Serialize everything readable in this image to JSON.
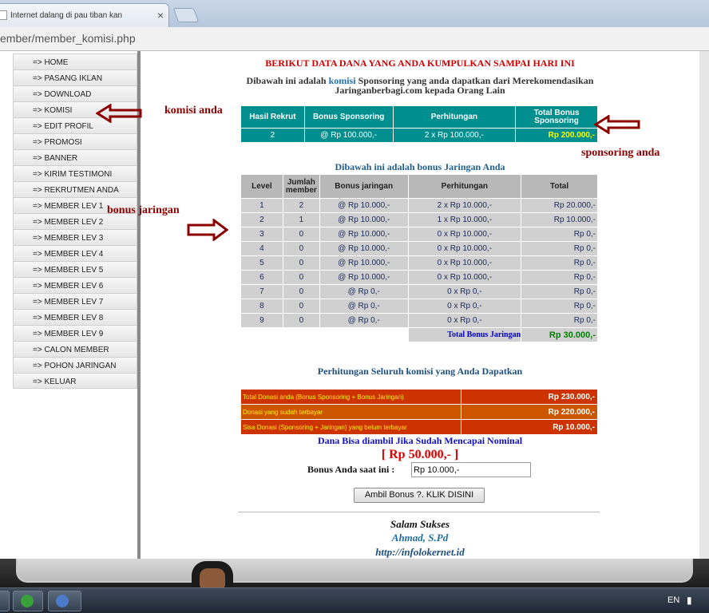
{
  "browser": {
    "tab_title": "Internet dalang di pau tiban kan",
    "url": "ember/member_komisi.php"
  },
  "sidebar": {
    "items": [
      "=> HOME",
      "=> PASANG IKLAN",
      "=> DOWNLOAD",
      "=> KOMISI",
      "=> EDIT PROFIL",
      "=> PROMOSI",
      "=> BANNER",
      "=> KIRIM TESTIMONI",
      "=> REKRUTMEN ANDA",
      "=> MEMBER LEV 1",
      "=> MEMBER LEV 2",
      "=> MEMBER LEV 3",
      "=> MEMBER LEV 4",
      "=> MEMBER LEV 5",
      "=> MEMBER LEV 6",
      "=> MEMBER LEV 7",
      "=> MEMBER LEV 8",
      "=> MEMBER LEV 9",
      "=> CALON MEMBER",
      "=> POHON JARINGAN",
      "=> KELUAR"
    ]
  },
  "main": {
    "heading": "BERIKUT DATA DANA YANG ANDA KUMPULKAN SAMPAI HARI INI",
    "intro_before": "Dibawah ini adalah ",
    "intro_link": "komisi",
    "intro_after": " Sponsoring yang anda dapatkan dari Merekomendasikan Jaringanberbagi.com kepada Orang Lain",
    "sponsor_table": {
      "headers": [
        "Hasil Rekrut",
        "Bonus Sponsoring",
        "Perhitungan",
        "Total Bonus Sponsoring"
      ],
      "row": [
        "2",
        "@ Rp 100.000,-",
        "2 x Rp 100.000,-",
        "Rp 200.000,-"
      ]
    },
    "jaringan_title": "Dibawah ini adalah bonus Jaringan Anda",
    "jaringan_table": {
      "headers": [
        "Level",
        "Jumlah member",
        "Bonus jaringan",
        "Perhitungan",
        "Total"
      ],
      "rows": [
        [
          "1",
          "2",
          "@ Rp 10.000,-",
          "2 x Rp 10.000,-",
          "Rp 20.000,-"
        ],
        [
          "2",
          "1",
          "@ Rp 10.000,-",
          "1 x Rp 10.000,-",
          "Rp 10.000,-"
        ],
        [
          "3",
          "0",
          "@ Rp 10.000,-",
          "0 x Rp 10.000,-",
          "Rp 0,-"
        ],
        [
          "4",
          "0",
          "@ Rp 10.000,-",
          "0 x Rp 10.000,-",
          "Rp 0,-"
        ],
        [
          "5",
          "0",
          "@ Rp 10.000,-",
          "0 x Rp 10.000,-",
          "Rp 0,-"
        ],
        [
          "6",
          "0",
          "@ Rp 10.000,-",
          "0 x Rp 10.000,-",
          "Rp 0,-"
        ],
        [
          "7",
          "0",
          "@ Rp 0,-",
          "0 x Rp 0,-",
          "Rp 0,-"
        ],
        [
          "8",
          "0",
          "@ Rp 0,-",
          "0 x Rp 0,-",
          "Rp 0,-"
        ],
        [
          "9",
          "0",
          "@ Rp 0,-",
          "0 x Rp 0,-",
          "Rp 0,-"
        ]
      ],
      "total_label": "Total Bonus Jaringan",
      "total_value": "Rp 30.000,-"
    },
    "perhitungan_title": "Perhitungan Seluruh komisi yang Anda Dapatkan",
    "summary_table": {
      "rows": [
        [
          "Total Donasi anda (Bonus Sponsoring + Bonus Jaringan)",
          "Rp 230.000,-"
        ],
        [
          "Donasi yang sudah terbayar",
          "Rp 220.000,-"
        ],
        [
          "Sisa Donasi (Sponsoring + Jaringan) yang belum terbayar",
          "Rp 10.000,-"
        ]
      ]
    },
    "dana_text": "Dana Bisa diambil Jika Sudah Mencapai Nominal",
    "nominal": "[ Rp 50.000,- ]",
    "bonus_label": "Bonus Anda saat ini :",
    "bonus_value": "Rp 10.000,-",
    "ambil_button": "Ambil Bonus ?. KLIK DISINI",
    "salam": "Salam Sukses",
    "nama": "Ahmad, S.Pd",
    "website": "http://infolokernet.id"
  },
  "annotations": {
    "komisi": "komisi anda",
    "sponsoring": "sponsoring anda",
    "jaringan": "bonus jaringan"
  },
  "taskbar": {
    "language": "EN"
  },
  "colors": {
    "teal": "#008f8f",
    "annotation": "#8b0000",
    "heading_red": "#d00000",
    "summary_row": "#cc3300"
  }
}
